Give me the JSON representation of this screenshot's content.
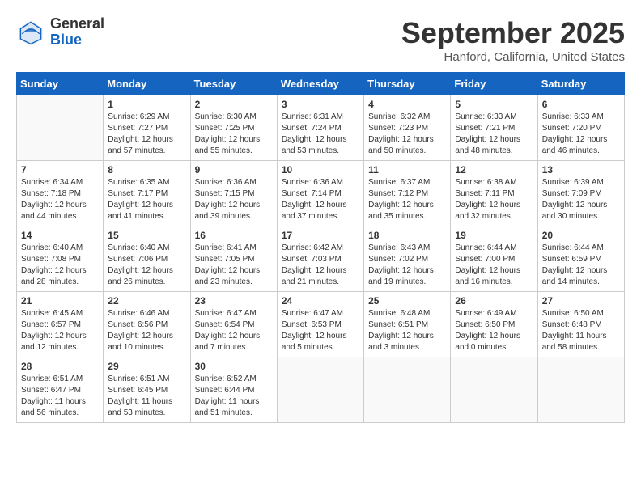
{
  "header": {
    "logo_general": "General",
    "logo_blue": "Blue",
    "month_title": "September 2025",
    "location": "Hanford, California, United States"
  },
  "days_of_week": [
    "Sunday",
    "Monday",
    "Tuesday",
    "Wednesday",
    "Thursday",
    "Friday",
    "Saturday"
  ],
  "weeks": [
    [
      {
        "day": "",
        "info": ""
      },
      {
        "day": "1",
        "info": "Sunrise: 6:29 AM\nSunset: 7:27 PM\nDaylight: 12 hours\nand 57 minutes."
      },
      {
        "day": "2",
        "info": "Sunrise: 6:30 AM\nSunset: 7:25 PM\nDaylight: 12 hours\nand 55 minutes."
      },
      {
        "day": "3",
        "info": "Sunrise: 6:31 AM\nSunset: 7:24 PM\nDaylight: 12 hours\nand 53 minutes."
      },
      {
        "day": "4",
        "info": "Sunrise: 6:32 AM\nSunset: 7:23 PM\nDaylight: 12 hours\nand 50 minutes."
      },
      {
        "day": "5",
        "info": "Sunrise: 6:33 AM\nSunset: 7:21 PM\nDaylight: 12 hours\nand 48 minutes."
      },
      {
        "day": "6",
        "info": "Sunrise: 6:33 AM\nSunset: 7:20 PM\nDaylight: 12 hours\nand 46 minutes."
      }
    ],
    [
      {
        "day": "7",
        "info": "Sunrise: 6:34 AM\nSunset: 7:18 PM\nDaylight: 12 hours\nand 44 minutes."
      },
      {
        "day": "8",
        "info": "Sunrise: 6:35 AM\nSunset: 7:17 PM\nDaylight: 12 hours\nand 41 minutes."
      },
      {
        "day": "9",
        "info": "Sunrise: 6:36 AM\nSunset: 7:15 PM\nDaylight: 12 hours\nand 39 minutes."
      },
      {
        "day": "10",
        "info": "Sunrise: 6:36 AM\nSunset: 7:14 PM\nDaylight: 12 hours\nand 37 minutes."
      },
      {
        "day": "11",
        "info": "Sunrise: 6:37 AM\nSunset: 7:12 PM\nDaylight: 12 hours\nand 35 minutes."
      },
      {
        "day": "12",
        "info": "Sunrise: 6:38 AM\nSunset: 7:11 PM\nDaylight: 12 hours\nand 32 minutes."
      },
      {
        "day": "13",
        "info": "Sunrise: 6:39 AM\nSunset: 7:09 PM\nDaylight: 12 hours\nand 30 minutes."
      }
    ],
    [
      {
        "day": "14",
        "info": "Sunrise: 6:40 AM\nSunset: 7:08 PM\nDaylight: 12 hours\nand 28 minutes."
      },
      {
        "day": "15",
        "info": "Sunrise: 6:40 AM\nSunset: 7:06 PM\nDaylight: 12 hours\nand 26 minutes."
      },
      {
        "day": "16",
        "info": "Sunrise: 6:41 AM\nSunset: 7:05 PM\nDaylight: 12 hours\nand 23 minutes."
      },
      {
        "day": "17",
        "info": "Sunrise: 6:42 AM\nSunset: 7:03 PM\nDaylight: 12 hours\nand 21 minutes."
      },
      {
        "day": "18",
        "info": "Sunrise: 6:43 AM\nSunset: 7:02 PM\nDaylight: 12 hours\nand 19 minutes."
      },
      {
        "day": "19",
        "info": "Sunrise: 6:44 AM\nSunset: 7:00 PM\nDaylight: 12 hours\nand 16 minutes."
      },
      {
        "day": "20",
        "info": "Sunrise: 6:44 AM\nSunset: 6:59 PM\nDaylight: 12 hours\nand 14 minutes."
      }
    ],
    [
      {
        "day": "21",
        "info": "Sunrise: 6:45 AM\nSunset: 6:57 PM\nDaylight: 12 hours\nand 12 minutes."
      },
      {
        "day": "22",
        "info": "Sunrise: 6:46 AM\nSunset: 6:56 PM\nDaylight: 12 hours\nand 10 minutes."
      },
      {
        "day": "23",
        "info": "Sunrise: 6:47 AM\nSunset: 6:54 PM\nDaylight: 12 hours\nand 7 minutes."
      },
      {
        "day": "24",
        "info": "Sunrise: 6:47 AM\nSunset: 6:53 PM\nDaylight: 12 hours\nand 5 minutes."
      },
      {
        "day": "25",
        "info": "Sunrise: 6:48 AM\nSunset: 6:51 PM\nDaylight: 12 hours\nand 3 minutes."
      },
      {
        "day": "26",
        "info": "Sunrise: 6:49 AM\nSunset: 6:50 PM\nDaylight: 12 hours\nand 0 minutes."
      },
      {
        "day": "27",
        "info": "Sunrise: 6:50 AM\nSunset: 6:48 PM\nDaylight: 11 hours\nand 58 minutes."
      }
    ],
    [
      {
        "day": "28",
        "info": "Sunrise: 6:51 AM\nSunset: 6:47 PM\nDaylight: 11 hours\nand 56 minutes."
      },
      {
        "day": "29",
        "info": "Sunrise: 6:51 AM\nSunset: 6:45 PM\nDaylight: 11 hours\nand 53 minutes."
      },
      {
        "day": "30",
        "info": "Sunrise: 6:52 AM\nSunset: 6:44 PM\nDaylight: 11 hours\nand 51 minutes."
      },
      {
        "day": "",
        "info": ""
      },
      {
        "day": "",
        "info": ""
      },
      {
        "day": "",
        "info": ""
      },
      {
        "day": "",
        "info": ""
      }
    ]
  ]
}
